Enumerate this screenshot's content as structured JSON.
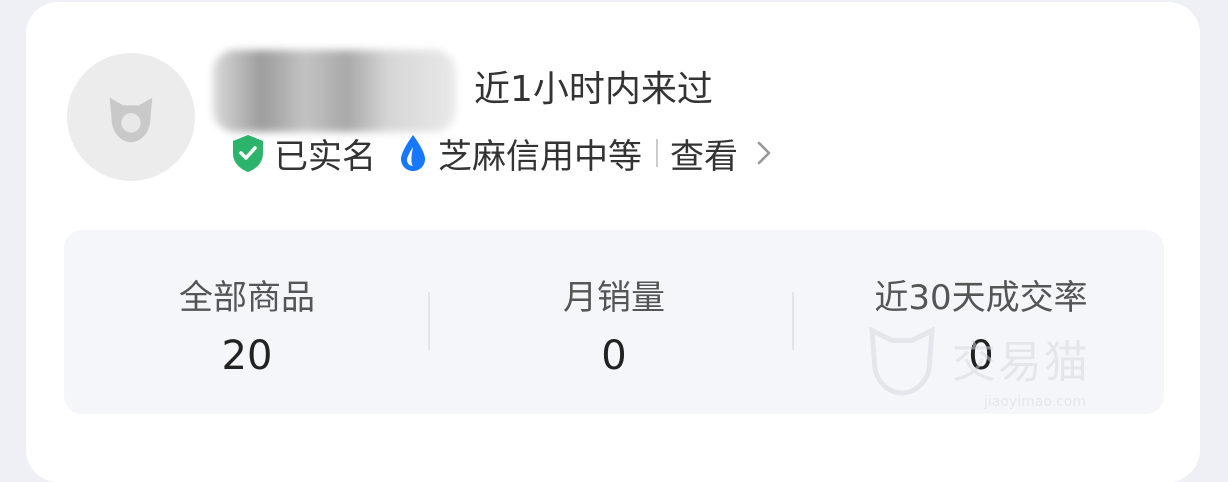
{
  "profile": {
    "last_active": "近1小时内来过",
    "verified_label": "已实名",
    "credit_label": "芝麻信用中等",
    "view_label": "查看"
  },
  "stats": [
    {
      "label": "全部商品",
      "value": "20"
    },
    {
      "label": "月销量",
      "value": "0"
    },
    {
      "label": "近30天成交率",
      "value": "0"
    }
  ],
  "watermark": {
    "text": "交易猫",
    "sub": "jiaoyimao.com"
  },
  "colors": {
    "verified": "#2db46b",
    "credit": "#1677ff"
  }
}
